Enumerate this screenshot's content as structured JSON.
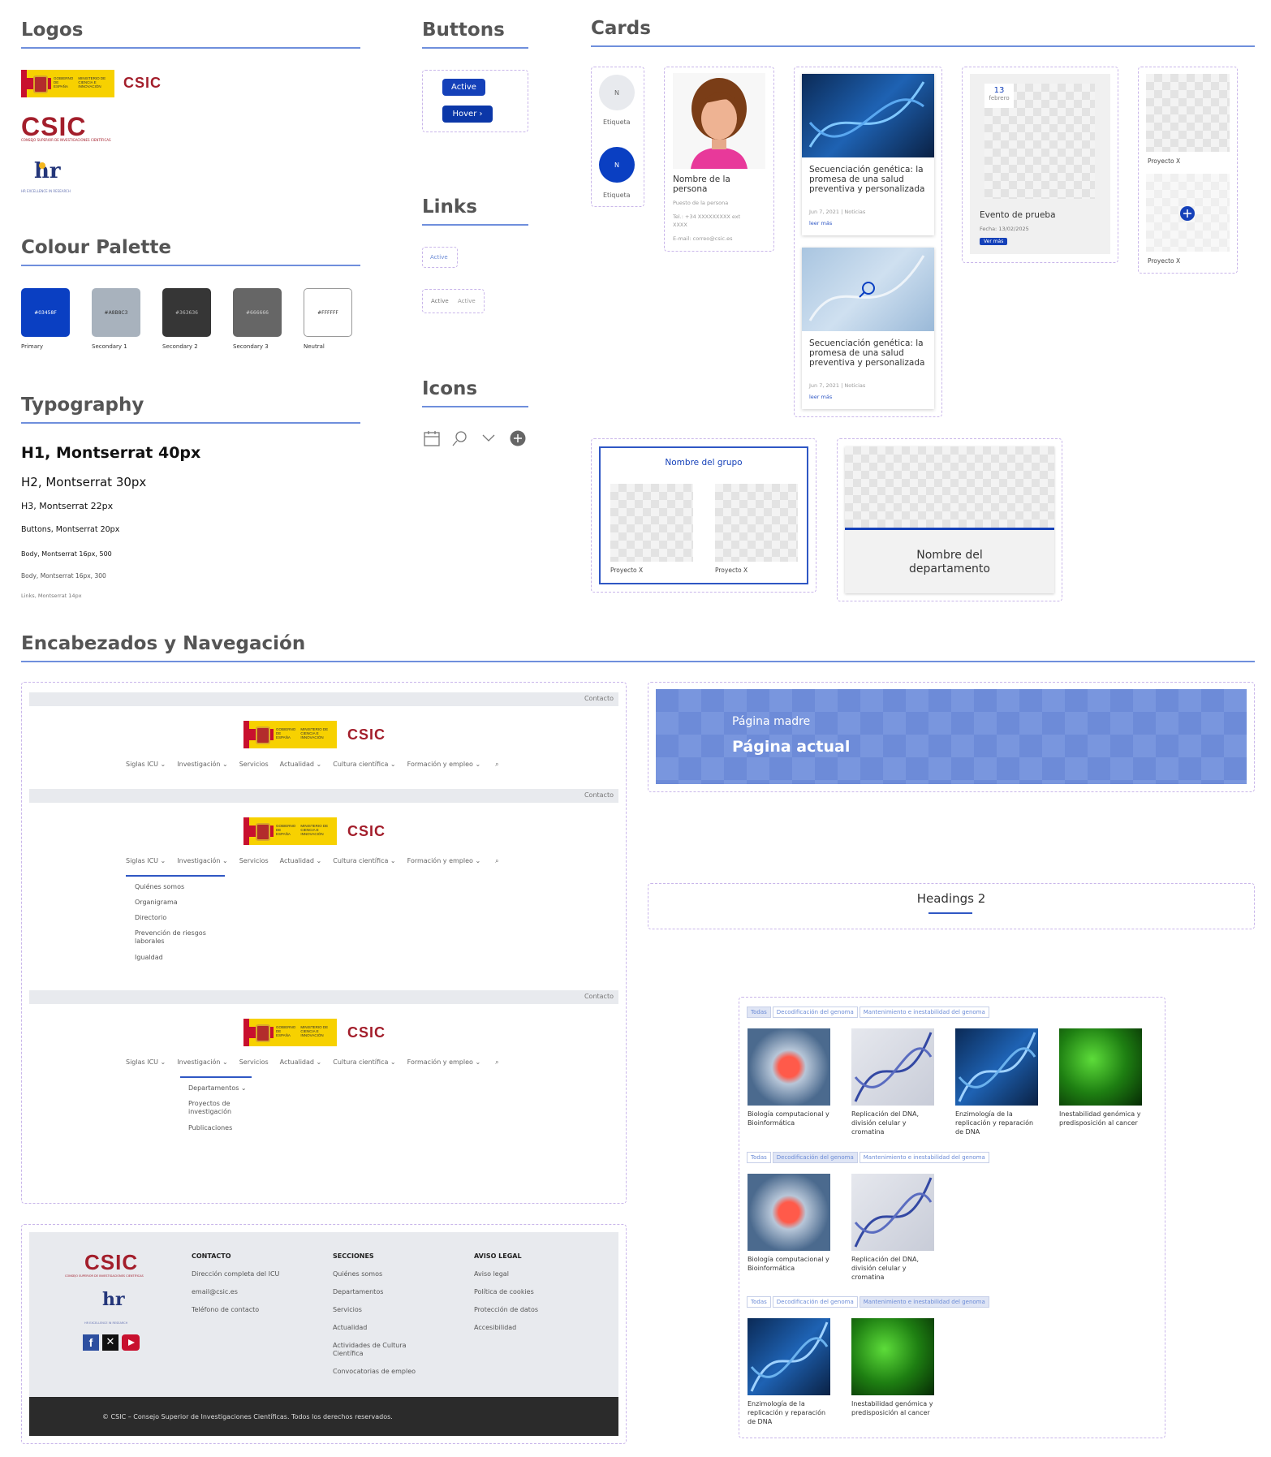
{
  "sections": {
    "logos": "Logos",
    "buttons": "Buttons",
    "cards": "Cards",
    "palette": "Colour Palette",
    "links": "Links",
    "typography": "Typography",
    "icons": "Icons",
    "nav": "Encabezados y Navegación"
  },
  "logos": {
    "gov_line1": "GOBIERNO DE ESPAÑA",
    "gov_line2": "MINISTERIO DE CIENCIA E INNOVACIÓN",
    "csic": "CSIC",
    "csic_sub": "CONSEJO SUPERIOR DE INVESTIGACIONES CIENTÍFICAS",
    "hr": "hr",
    "hr_sub": "HR EXCELLENCE IN RESEARCH"
  },
  "palette": [
    {
      "hex": "#03458F",
      "label": "Primary",
      "color": "#0a3fc2",
      "text": "#ffffff"
    },
    {
      "hex": "#A8B8C3",
      "label": "Secondary 1",
      "color": "#a8b2bd",
      "text": "#333333"
    },
    {
      "hex": "#363636",
      "label": "Secondary 2",
      "color": "#363636",
      "text": "#bbbbbb"
    },
    {
      "hex": "#666666",
      "label": "Secondary 3",
      "color": "#666666",
      "text": "#cccccc"
    },
    {
      "hex": "#FFFFFF",
      "label": "Neutral",
      "color": "#ffffff",
      "text": "#333333"
    }
  ],
  "typography": {
    "h1": "H1, Montserrat 40px",
    "h2": "H2, Montserrat 30px",
    "h3": "H3, Montserrat 22px",
    "buttons": "Buttons, Montserrat 20px",
    "body500": "Body, Montserrat 16px, 500",
    "body300": "Body, Montserrat 16px, 300",
    "links": "Links, Montserrat 14px"
  },
  "buttons": {
    "active": "Active",
    "hover": "Hover ›"
  },
  "links": {
    "single": "Active",
    "pair_a": "Active",
    "pair_b": "Active"
  },
  "icons": [
    "calendar-icon",
    "search-icon",
    "chevron-down-icon",
    "plus-circle-icon"
  ],
  "cards": {
    "avatar_initial": "N",
    "avatar_label": "Etiqueta",
    "person": {
      "name": "Nombre de la persona",
      "role": "Puesto de la persona",
      "tel": "Tel.: +34 XXXXXXXXX ext XXXX",
      "email": "E-mail: correo@csic.es"
    },
    "news": {
      "title": "Secuenciación genética: la promesa de una salud preventiva y personalizada",
      "meta": "Jun 7, 2021 | Noticias",
      "link": "leer más"
    },
    "event": {
      "day": "13",
      "month": "febrero",
      "title": "Evento de prueba",
      "date": "Fecha: 13/02/2025",
      "button": "Ver más"
    },
    "project": "Proyecto X",
    "group": {
      "title": "Nombre del grupo",
      "p1": "Proyecto X",
      "p2": "Proyecto X"
    },
    "dept": "Nombre del departamento"
  },
  "nav": {
    "contact": "Contacto",
    "menu": [
      "Siglas ICU ⌄",
      "Investigación ⌄",
      "Servicios",
      "Actualidad ⌄",
      "Cultura científica ⌄",
      "Formación y empleo ⌄"
    ],
    "sub1": [
      "Quiénes somos",
      "Organigrama",
      "Directorio",
      "Prevención de riesgos laborales",
      "Igualdad"
    ],
    "sub2": [
      "Departamentos ⌄",
      "Proyectos de investigación",
      "Publicaciones"
    ]
  },
  "hero": {
    "parent": "Página madre",
    "current": "Página actual"
  },
  "headings2": "Headings 2",
  "footer": {
    "contact_h": "CONTACTO",
    "contact": [
      "Dirección completa del ICU",
      "email@csic.es",
      "Teléfono de contacto"
    ],
    "sections_h": "SECCIONES",
    "sections": [
      "Quiénes somos",
      "Departamentos",
      "Servicios",
      "Actualidad",
      "Actividades de Cultura Científica",
      "Convocatorias de empleo"
    ],
    "legal_h": "AVISO LEGAL",
    "legal": [
      "Aviso legal",
      "Política de cookies",
      "Protección de datos",
      "Accesibilidad"
    ],
    "copyright": "© CSIC – Consejo Superior de Investigaciones Científicas. Todos los derechos reservados."
  },
  "filter": {
    "tabs": [
      "Todas",
      "Decodificación del genoma",
      "Mantenimiento e inestabilidad del genoma"
    ],
    "items": [
      "Biología computacional y Bioinformática",
      "Replicación del DNA, división celular y cromatina",
      "Enzimología de la replicación y reparación de DNA",
      "Inestabilidad genómica y predisposición al cancer"
    ]
  }
}
